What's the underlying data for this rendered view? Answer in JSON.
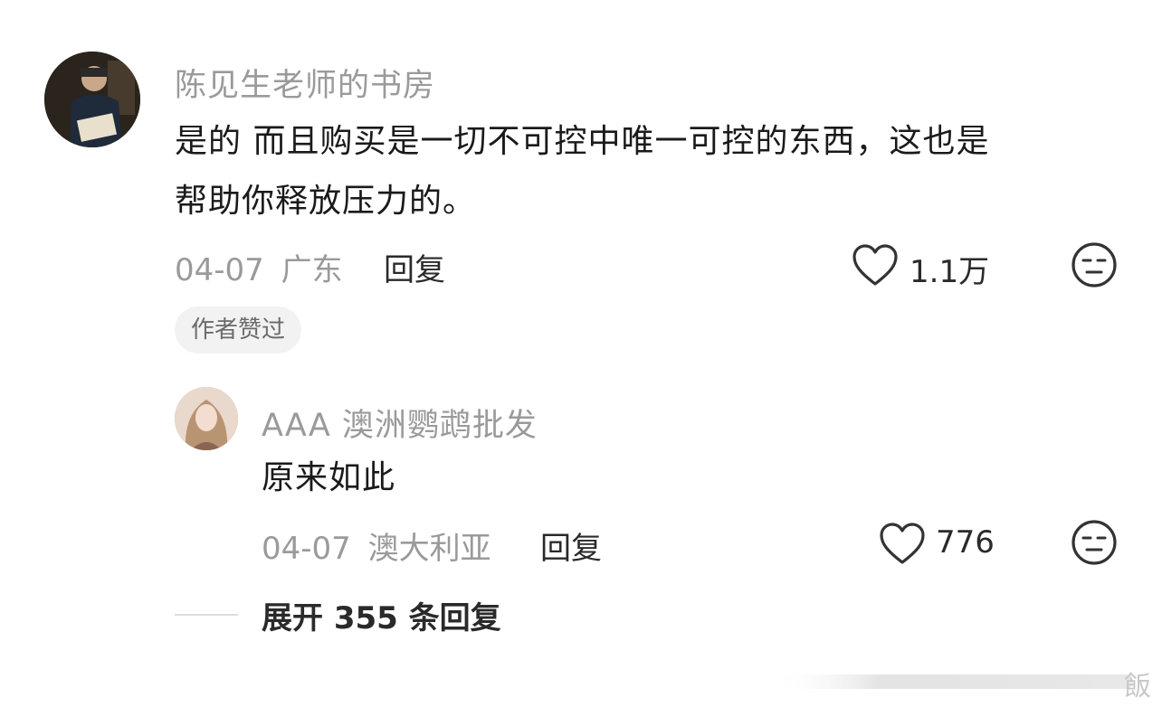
{
  "comment": {
    "username": "陈见生老师的书房",
    "content_line1": "是的 而且购买是一切不可控中唯一可控的东西，这也是",
    "content_line2": "帮助你释放压力的。",
    "date": "04-07",
    "location": "广东",
    "reply_label": "回复",
    "like_count": "1.1万",
    "badge": "作者赞过"
  },
  "reply": {
    "username": "AAA 澳洲鹦鹉批发",
    "content": "原来如此",
    "date": "04-07",
    "location": "澳大利亚",
    "reply_label": "回复",
    "like_count": "776"
  },
  "expand_label": "展开 355 条回复",
  "watermark_text": "飯",
  "icons": {
    "like": "heart-outline-icon",
    "dislike": "meh-face-icon"
  },
  "colors": {
    "text_primary": "#1a1a1a",
    "text_secondary": "#9a9a9a",
    "badge_bg": "#f2f2f2"
  }
}
